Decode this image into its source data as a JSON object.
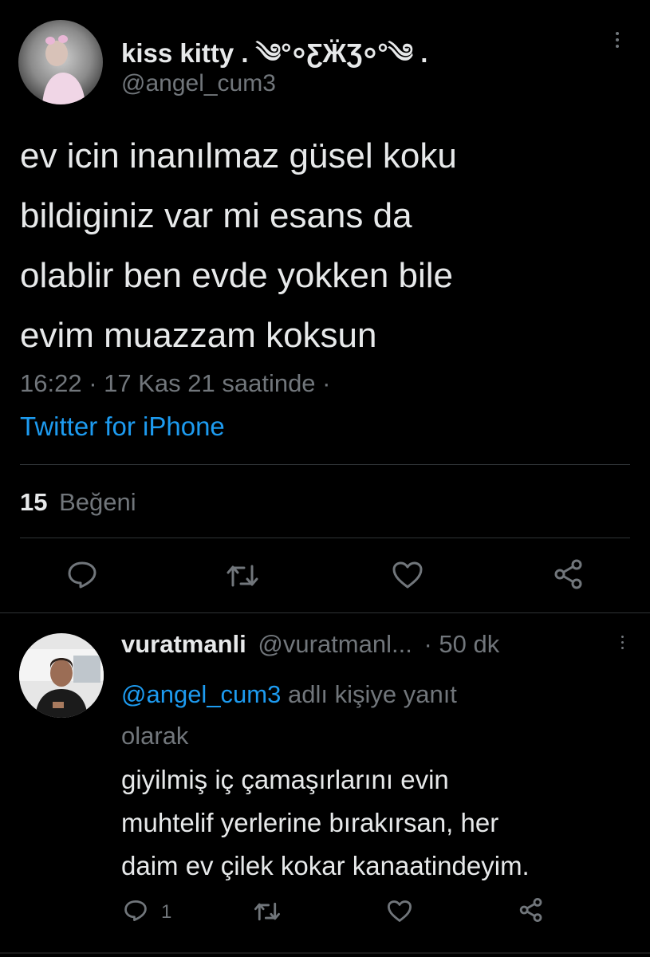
{
  "tweet": {
    "author_name": "kiss kitty . ༄°⸰ƸӜƷ⸰°༄ .",
    "author_handle": "@angel_cum3",
    "text_lines": [
      "ev icin inanılmaz güsel koku",
      "bildiginiz var mi esans da",
      "olablir ben evde yokken bile",
      "evim muazzam koksun"
    ],
    "meta": "16:22 · 17 Kas 21 saatinde ·",
    "source": "Twitter for iPhone",
    "likes_count": "15",
    "likes_label": "Beğeni",
    "actions": [
      "reply-icon",
      "retweet-icon",
      "like-icon",
      "share-icon"
    ]
  },
  "reply": {
    "author_name": "vuratmanli",
    "author_handle": "@vuratmanl...",
    "time": "· 50 dk",
    "replying_to_handle": "@angel_cum3",
    "replying_to_suffix": " adlı kişiye yanıt",
    "replying_to_line2": "olarak",
    "text_lines": [
      "giyilmiş iç çamaşırlarını evin",
      "muhtelif yerlerine bırakırsan, her",
      "daim ev çilek kokar kanaatindeyim."
    ],
    "reply_count": "1",
    "actions": [
      "reply-icon",
      "retweet-icon",
      "like-icon",
      "share-icon"
    ]
  },
  "colors": {
    "background": "#000000",
    "text": "#e7e9ea",
    "secondary": "#71767b",
    "link": "#1d9bf0",
    "divider": "#2f3336"
  }
}
